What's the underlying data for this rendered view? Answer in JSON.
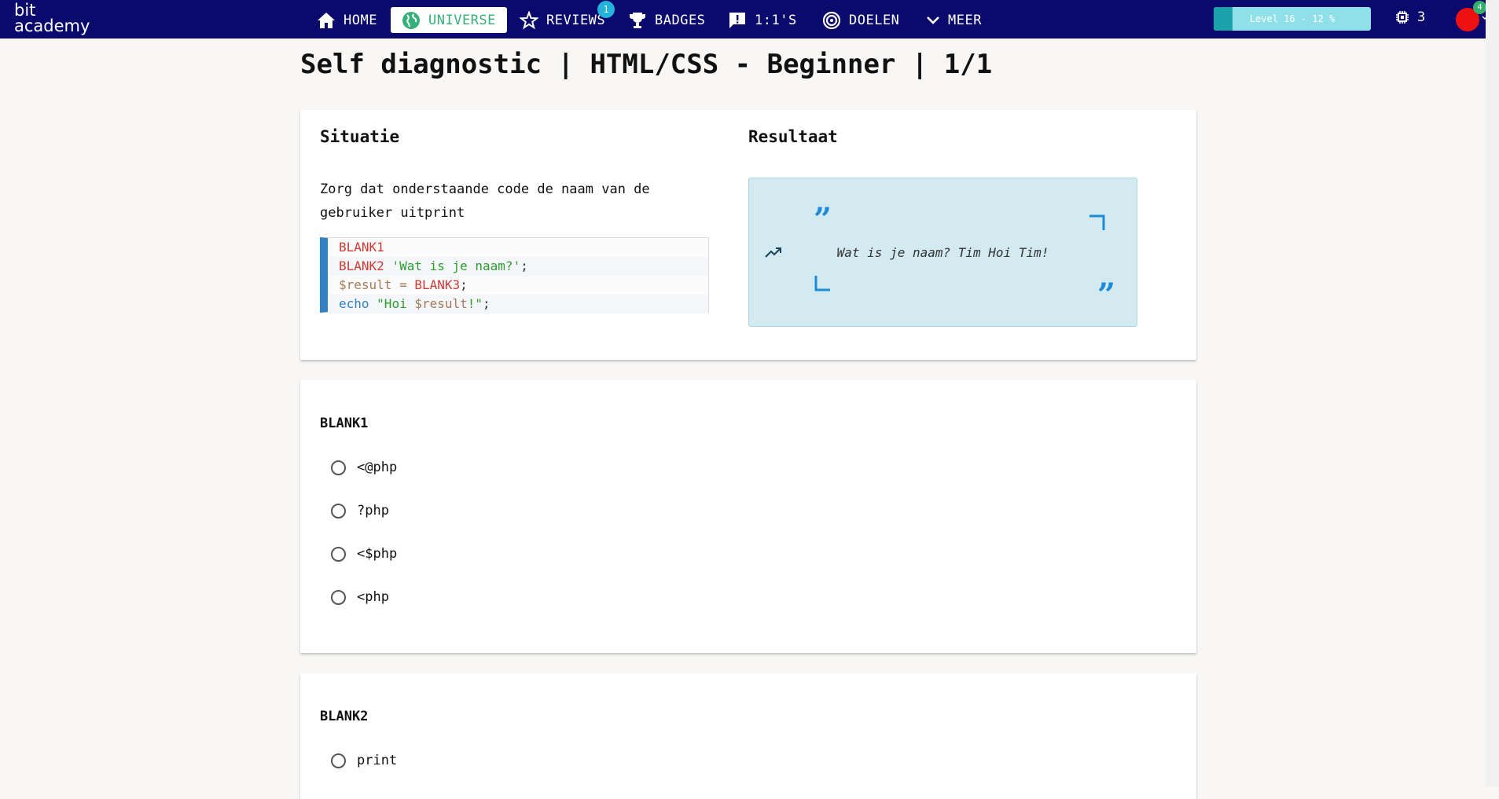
{
  "nav": {
    "logo_line1": "bit",
    "logo_line2": "academy",
    "items": [
      {
        "label": "HOME",
        "icon": "home-icon"
      },
      {
        "label": "UNIVERSE",
        "icon": "globe-icon",
        "active": true
      },
      {
        "label": "REVIEWS",
        "icon": "star-icon",
        "badge": "1"
      },
      {
        "label": "BADGES",
        "icon": "trophy-icon"
      },
      {
        "label": "1:1'S",
        "icon": "feedback-icon"
      },
      {
        "label": "DOELEN",
        "icon": "target-icon"
      },
      {
        "label": "MEER",
        "icon": "chevron-down-icon"
      }
    ],
    "level": {
      "text": "Level 16 - 12 %",
      "progress": 0.12
    },
    "chip_count": "3",
    "avatar_badge": "4",
    "colors": {
      "bar": "#0a0a6e",
      "accent": "#35b07a",
      "avatar": "#ee1111"
    }
  },
  "page": {
    "title": "Self diagnostic | HTML/CSS - Beginner | 1/1"
  },
  "situation": {
    "title": "Situatie",
    "description": "Zorg dat onderstaande code de naam van de gebruiker uitprint",
    "code": {
      "line1": "BLANK1",
      "line2_kw": "BLANK2",
      "line2_str": "'Wat is je naam?'",
      "line2_end": ";",
      "line3_var": "$result",
      "line3_eq": " = ",
      "line3_blank": "BLANK3",
      "line3_end": ";",
      "line4_kw": "echo",
      "line4_str_open": "\"Hoi ",
      "line4_var": "$result",
      "line4_str_close": "!\"",
      "line4_end": ";"
    }
  },
  "result": {
    "title": "Resultaat",
    "text": "Wat is je naam? Tim Hoi Tim!"
  },
  "questions": [
    {
      "blank": "BLANK1",
      "options": [
        "<@php",
        "?php",
        "<$php",
        "<php"
      ]
    },
    {
      "blank": "BLANK2",
      "options": [
        "print"
      ]
    }
  ]
}
